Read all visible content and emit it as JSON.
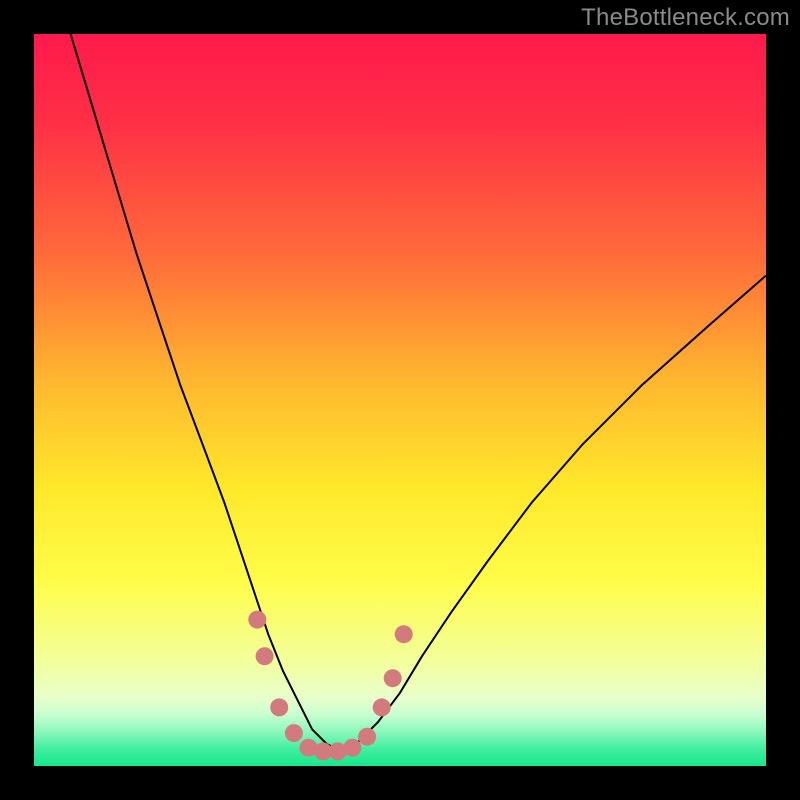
{
  "watermark": "TheBottleneck.com",
  "chart_data": {
    "type": "line",
    "title": "",
    "xlabel": "",
    "ylabel": "",
    "xlim": [
      0,
      100
    ],
    "ylim": [
      0,
      100
    ],
    "gradient_stops": [
      {
        "offset": 0.0,
        "color": "#ff1a4b"
      },
      {
        "offset": 0.12,
        "color": "#ff2f46"
      },
      {
        "offset": 0.3,
        "color": "#ff6a3a"
      },
      {
        "offset": 0.48,
        "color": "#ffb92f"
      },
      {
        "offset": 0.62,
        "color": "#ffe82a"
      },
      {
        "offset": 0.75,
        "color": "#fffd4a"
      },
      {
        "offset": 0.86,
        "color": "#f2ff9e"
      },
      {
        "offset": 0.905,
        "color": "#e9ffc9"
      },
      {
        "offset": 0.93,
        "color": "#c8ffd1"
      },
      {
        "offset": 0.955,
        "color": "#86f7b8"
      },
      {
        "offset": 0.978,
        "color": "#3de e9e"
      },
      {
        "offset": 1.0,
        "color": "#17e889"
      }
    ],
    "series": [
      {
        "name": "bottleneck-curve",
        "stroke": "#000000",
        "stroke_width": 2,
        "x": [
          5,
          8,
          11,
          14,
          17,
          20,
          23,
          26,
          28,
          30,
          32,
          34,
          36,
          38,
          40,
          42,
          44,
          47,
          50,
          53,
          57,
          62,
          68,
          75,
          83,
          92,
          100
        ],
        "y": [
          100,
          90,
          80,
          70,
          61,
          52,
          44,
          36,
          30,
          24,
          18,
          13,
          9,
          5,
          3,
          2,
          3,
          6,
          10,
          15,
          21,
          28,
          36,
          44,
          52,
          60,
          67
        ]
      },
      {
        "name": "highlight-dots",
        "type": "scatter",
        "fill": "#d27a7d",
        "radius": 9,
        "points": [
          {
            "x": 30.5,
            "y": 20
          },
          {
            "x": 31.5,
            "y": 15
          },
          {
            "x": 33.5,
            "y": 8
          },
          {
            "x": 35.5,
            "y": 4.5
          },
          {
            "x": 37.5,
            "y": 2.5
          },
          {
            "x": 39.5,
            "y": 2
          },
          {
            "x": 41.5,
            "y": 2
          },
          {
            "x": 43.5,
            "y": 2.5
          },
          {
            "x": 45.5,
            "y": 4
          },
          {
            "x": 47.5,
            "y": 8
          },
          {
            "x": 49.0,
            "y": 12
          },
          {
            "x": 50.5,
            "y": 18
          }
        ]
      }
    ]
  }
}
